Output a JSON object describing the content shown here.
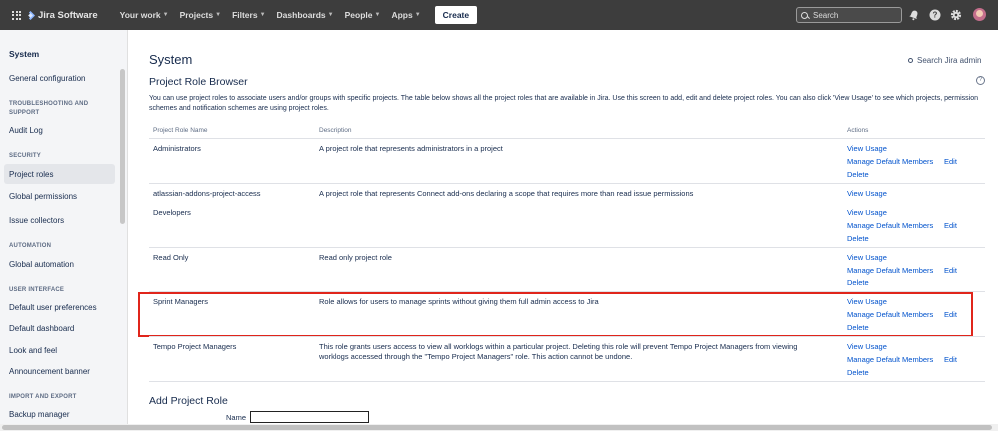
{
  "topnav": {
    "logo": "Jira Software",
    "items": [
      "Your work",
      "Projects",
      "Filters",
      "Dashboards",
      "People",
      "Apps"
    ],
    "create_label": "Create",
    "search_placeholder": "Search"
  },
  "sidebar": {
    "title": "System",
    "general": "General configuration",
    "sections": [
      {
        "heading": "TROUBLESHOOTING AND SUPPORT",
        "items": [
          "Audit Log"
        ]
      },
      {
        "heading": "SECURITY",
        "items": [
          "Project roles",
          "Global permissions",
          "Issue collectors"
        ]
      },
      {
        "heading": "AUTOMATION",
        "items": [
          "Global automation"
        ]
      },
      {
        "heading": "USER INTERFACE",
        "items": [
          "Default user preferences",
          "Default dashboard",
          "Look and feel",
          "Announcement banner"
        ]
      },
      {
        "heading": "IMPORT AND EXPORT",
        "items": [
          "Backup manager"
        ]
      }
    ]
  },
  "main": {
    "page_title": "System",
    "admin_search": "Search Jira admin",
    "section_title": "Project Role Browser",
    "help": "?",
    "intro": "You can use project roles to associate users and/or groups with specific projects. The table below shows all the project roles that are available in Jira. Use this screen to add, edit and delete project roles. You can also click 'View Usage' to see which projects, permission schemes and notification schemes are using project roles.",
    "table": {
      "headers": [
        "Project Role Name",
        "Description",
        "Actions"
      ],
      "rows": [
        {
          "name": "Administrators",
          "description": "A project role that represents administrators in a project",
          "actions": {
            "view": "View Usage",
            "manage": "Manage Default Members",
            "edit": "Edit",
            "delete": "Delete"
          }
        },
        {
          "name": "atlassian-addons-project-access",
          "description": "A project role that represents Connect add-ons declaring a scope that requires more than read issue permissions",
          "actions": {
            "view": "View Usage"
          }
        },
        {
          "name": "Developers",
          "description": "",
          "actions": {
            "view": "View Usage",
            "manage": "Manage Default Members",
            "edit": "Edit",
            "delete": "Delete"
          }
        },
        {
          "name": "Read Only",
          "description": "Read only project role",
          "actions": {
            "view": "View Usage",
            "manage": "Manage Default Members",
            "edit": "Edit",
            "delete": "Delete"
          }
        },
        {
          "name": "Sprint Managers",
          "description": "Role allows for users to manage sprints without giving them full admin access to Jira",
          "actions": {
            "view": "View Usage",
            "manage": "Manage Default Members",
            "edit": "Edit",
            "delete": "Delete"
          }
        },
        {
          "name": "Tempo Project Managers",
          "description": "This role grants users access to view all worklogs within a particular project. Deleting this role will prevent Tempo Project Managers from viewing worklogs accessed through the \"Tempo Project Managers\" role. This action cannot be undone.",
          "actions": {
            "view": "View Usage",
            "manage": "Manage Default Members",
            "edit": "Edit",
            "delete": "Delete"
          }
        }
      ]
    },
    "add_title": "Add Project Role",
    "name_label": "Name",
    "name_value": ""
  },
  "colors": {
    "link": "#0052cc",
    "highlight": "#e0251b",
    "topnav": "#3d3d3d"
  }
}
